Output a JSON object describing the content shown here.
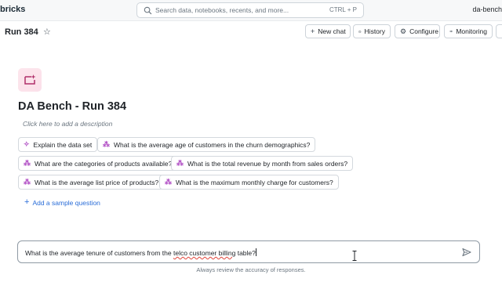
{
  "topbar": {
    "brand": "bricks",
    "search_placeholder": "Search data, notebooks, recents, and more...",
    "search_shortcut": "CTRL + P",
    "workspace": "da-bench"
  },
  "header": {
    "title": "Run 384",
    "buttons": {
      "new_chat": "New chat",
      "history": "History",
      "configure": "Configure",
      "monitoring": "Monitoring"
    }
  },
  "space": {
    "title": "DA Bench - Run 384",
    "description_placeholder": "Click here to add a description"
  },
  "sample_questions": [
    "Explain the data set",
    "What is the average age of customers in the churn demographics?",
    "What are the categories of products available?",
    "What is the total revenue by month from sales orders?",
    "What is the average list price of products?",
    "What is the maximum monthly charge for customers?"
  ],
  "add_question_label": "Add a sample question",
  "input": {
    "text_before": "What is the average tenure of customers from the ",
    "text_typo": "telco customer billing",
    "text_after": " table?"
  },
  "footer_note": "Always review the accuracy of responses.",
  "colors": {
    "accent_link": "#2a6dd8",
    "sparkle_icon": "#b04cc4",
    "space_icon_bg": "#fde6ec",
    "input_border": "#8f9aa4"
  }
}
